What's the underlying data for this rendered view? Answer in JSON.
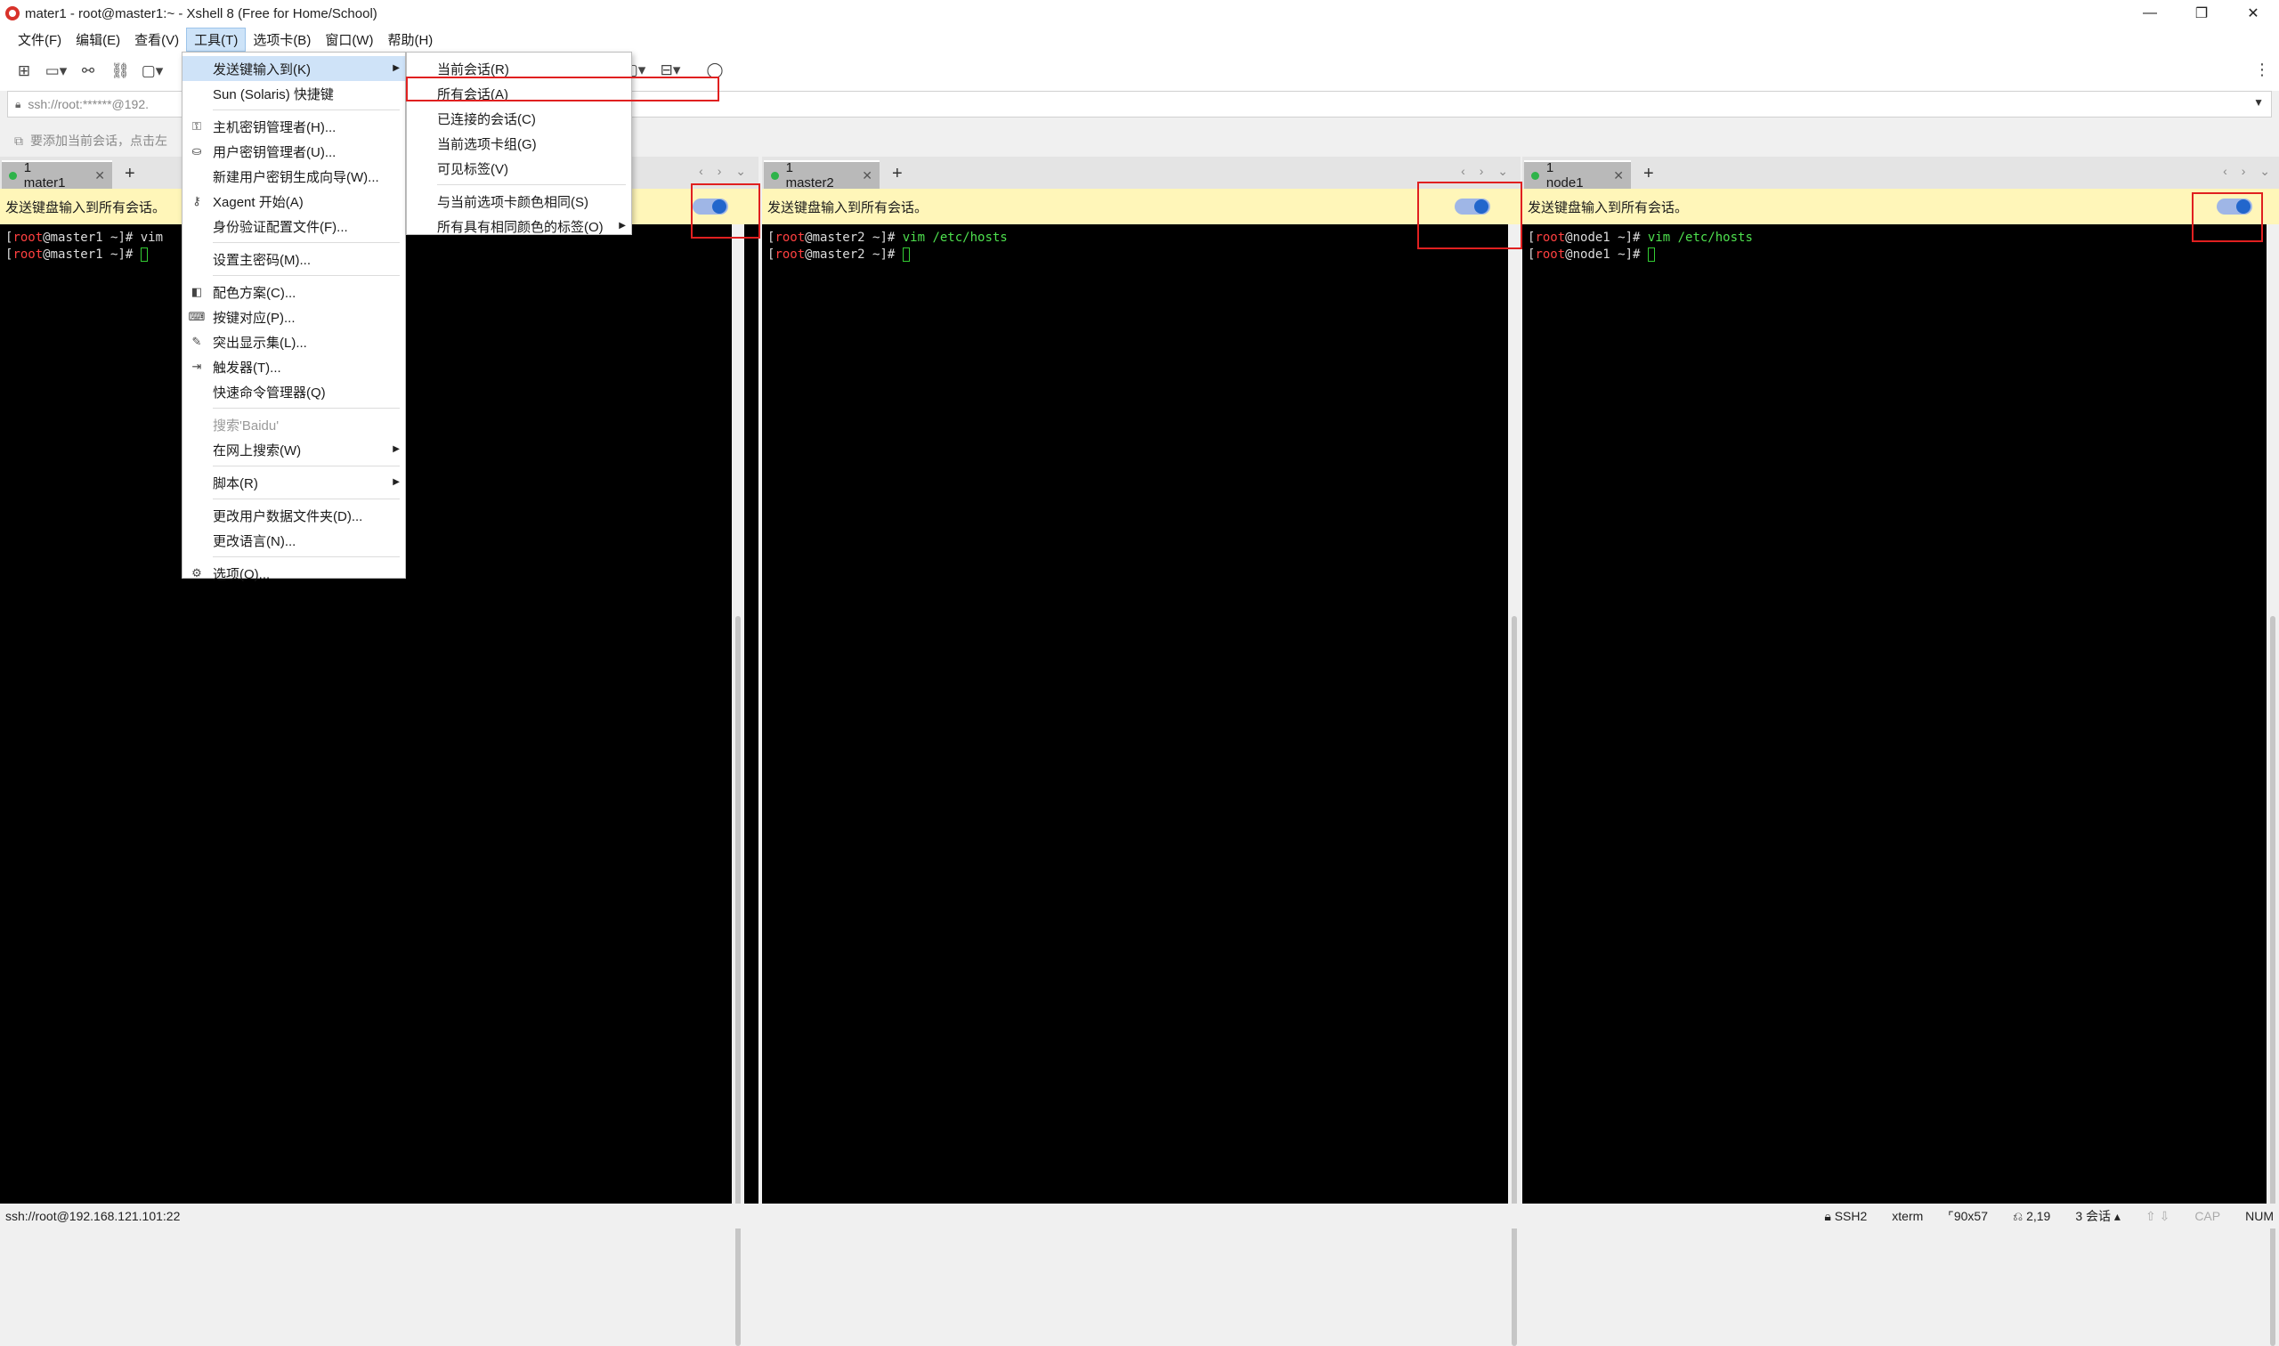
{
  "window": {
    "title": "mater1 - root@master1:~ - Xshell 8 (Free for Home/School)",
    "controls": [
      "—",
      "❐",
      "✕"
    ]
  },
  "menubar": [
    "文件(F)",
    "编辑(E)",
    "查看(V)",
    "工具(T)",
    "选项卡(B)",
    "窗口(W)",
    "帮助(H)"
  ],
  "address": {
    "text": "ssh://root:******@192."
  },
  "hint": {
    "text": "要添加当前会话，点击左"
  },
  "tools_menu": {
    "items": [
      {
        "label": "发送键输入到(K)",
        "icon": "",
        "submenu": true
      },
      {
        "label": "Sun (Solaris) 快捷键",
        "icon": ""
      },
      {
        "label": "主机密钥管理者(H)...",
        "icon": "key-host-icon"
      },
      {
        "label": "用户密钥管理者(U)...",
        "icon": "user-key-icon"
      },
      {
        "label": "新建用户密钥生成向导(W)...",
        "icon": ""
      },
      {
        "label": "Xagent 开始(A)",
        "icon": "xagent-icon"
      },
      {
        "label": "身份验证配置文件(F)...",
        "icon": ""
      },
      {
        "label": "设置主密码(M)...",
        "icon": ""
      },
      {
        "label": "配色方案(C)...",
        "icon": "color-scheme-icon"
      },
      {
        "label": "按键对应(P)...",
        "icon": "keyboard-icon"
      },
      {
        "label": "突出显示集(L)...",
        "icon": "highlight-icon"
      },
      {
        "label": "触发器(T)...",
        "icon": "trigger-icon"
      },
      {
        "label": "快速命令管理器(Q)",
        "icon": ""
      },
      {
        "label": "搜索'Baidu'",
        "icon": ""
      },
      {
        "label": "在网上搜索(W)",
        "icon": ""
      },
      {
        "label": "脚本(R)",
        "icon": ""
      },
      {
        "label": "更改用户数据文件夹(D)...",
        "icon": ""
      },
      {
        "label": "更改语言(N)...",
        "icon": ""
      },
      {
        "label": "选项(O)...",
        "icon": "gear-icon"
      }
    ]
  },
  "send_submenu": {
    "items": [
      {
        "label": "当前会话(R)"
      },
      {
        "label": "所有会话(A)"
      },
      {
        "label": "已连接的会话(C)"
      },
      {
        "label": "当前选项卡组(G)"
      },
      {
        "label": "可见标签(V)"
      },
      {
        "label": "与当前选项卡颜色相同(S)"
      },
      {
        "label": "所有具有相同颜色的标签(O)"
      }
    ]
  },
  "panes": [
    {
      "tab": "1 mater1",
      "notice": "发送键盘输入到所有会话。",
      "prompt1": "root",
      "host1": "@master1 ~]# ",
      "cmd1": "vim",
      "prompt2": "root",
      "host2": "@master1 ~]# "
    },
    {
      "tab": "1 master2",
      "notice": "发送键盘输入到所有会话。",
      "prompt1": "root",
      "host1": "@master2 ~]# ",
      "cmd1": "vim /etc/hosts",
      "prompt2": "root",
      "host2": "@master2 ~]# "
    },
    {
      "tab": "1 node1",
      "notice": "发送键盘输入到所有会话。",
      "prompt1": "root",
      "host1": "@node1 ~]# ",
      "cmd1": "vim /etc/hosts",
      "prompt2": "root",
      "host2": "@node1 ~]# "
    }
  ],
  "statusbar": {
    "left": "ssh://root@192.168.121.101:22",
    "protocol": "SSH2",
    "term": "xterm",
    "size": "90x57",
    "pos": "2,19",
    "sessions": "3 会话",
    "cap": "CAP",
    "num": "NUM"
  },
  "colors": {
    "accent": "#2266cc",
    "notice_bg": "#fff6b9",
    "highlight": "#e02020",
    "online": "#2fb34a"
  }
}
